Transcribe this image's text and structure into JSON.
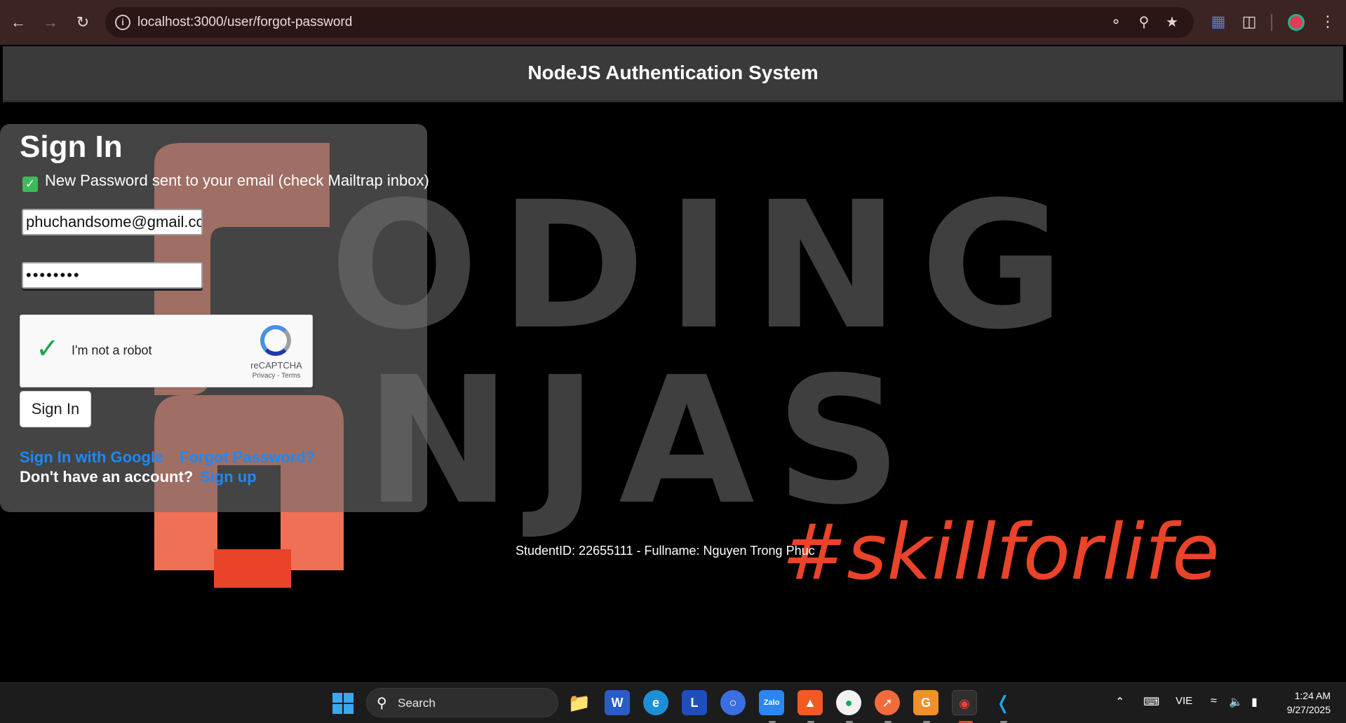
{
  "browser": {
    "url": "localhost:3000/user/forgot-password",
    "icons": [
      "back-icon",
      "forward-icon",
      "reload-icon",
      "site-info-icon",
      "key-icon",
      "zoom-icon",
      "star-icon",
      "translate-icon",
      "extensions-icon",
      "profile-icon",
      "menu-icon"
    ]
  },
  "header": {
    "title": "NodeJS Authentication System"
  },
  "signin": {
    "title": "Sign In",
    "message": "New Password sent to your email (check Mailtrap inbox)",
    "email_value": "phuchandsome@gmail.cc",
    "password_value": "••••••••",
    "recaptcha": {
      "label": "I'm not a robot",
      "brand": "reCAPTCHA",
      "terms": "Privacy - Terms"
    },
    "button": "Sign In",
    "google_link": "Sign In with Google",
    "forgot_link": "Forgot Password?",
    "no_account": "Don't have an account?",
    "signup_link": "Sign up"
  },
  "background": {
    "line1": "ODING",
    "line2": "NJAS",
    "tagline": "#skillforlife"
  },
  "footer": {
    "student": "StudentID: 22655111 - Fullname: Nguyen Trong Phuc"
  },
  "taskbar": {
    "search": "Search",
    "language": "VIE",
    "time": "1:24 AM",
    "date": "9/27/2025",
    "apps": [
      "file-explorer",
      "word",
      "edge",
      "l-app",
      "chromium",
      "zalo",
      "brave",
      "mongodb-compass",
      "postman",
      "foxit",
      "chrome",
      "vscode"
    ]
  },
  "colors": {
    "accent_link": "#1e88f5",
    "chrome_bg": "#3c2423",
    "tagline": "#e9432a"
  }
}
